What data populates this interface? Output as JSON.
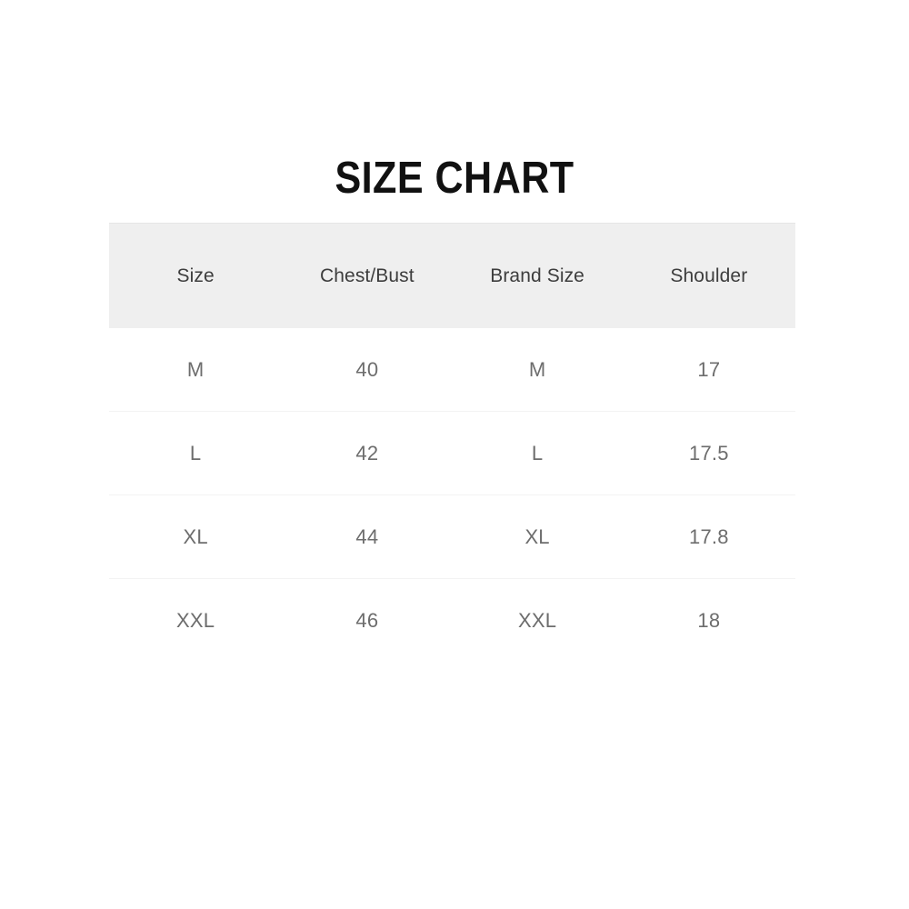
{
  "title": "SIZE CHART",
  "colors": {
    "page_background": "#ffffff",
    "title_text": "#111111",
    "header_background": "#efefef",
    "header_text": "#3d3d3d",
    "cell_text": "#6d6d6d",
    "row_divider": "#f3f3f3"
  },
  "chart_data": {
    "type": "table",
    "title": "SIZE CHART",
    "columns": [
      "Size",
      "Chest/Bust",
      "Brand Size",
      "Shoulder"
    ],
    "rows": [
      [
        "M",
        "40",
        "M",
        "17"
      ],
      [
        "L",
        "42",
        "L",
        "17.5"
      ],
      [
        "XL",
        "44",
        "XL",
        "17.8"
      ],
      [
        "XXL",
        "46",
        "XXL",
        "18"
      ]
    ]
  },
  "table": {
    "headers": [
      {
        "label": "Size"
      },
      {
        "label": "Chest/Bust"
      },
      {
        "label": "Brand Size"
      },
      {
        "label": "Shoulder"
      }
    ],
    "rows": [
      {
        "size": "M",
        "chest": "40",
        "brand_size": "M",
        "shoulder": "17"
      },
      {
        "size": "L",
        "chest": "42",
        "brand_size": "L",
        "shoulder": "17.5"
      },
      {
        "size": "XL",
        "chest": "44",
        "brand_size": "XL",
        "shoulder": "17.8"
      },
      {
        "size": "XXL",
        "chest": "46",
        "brand_size": "XXL",
        "shoulder": "18"
      }
    ]
  }
}
